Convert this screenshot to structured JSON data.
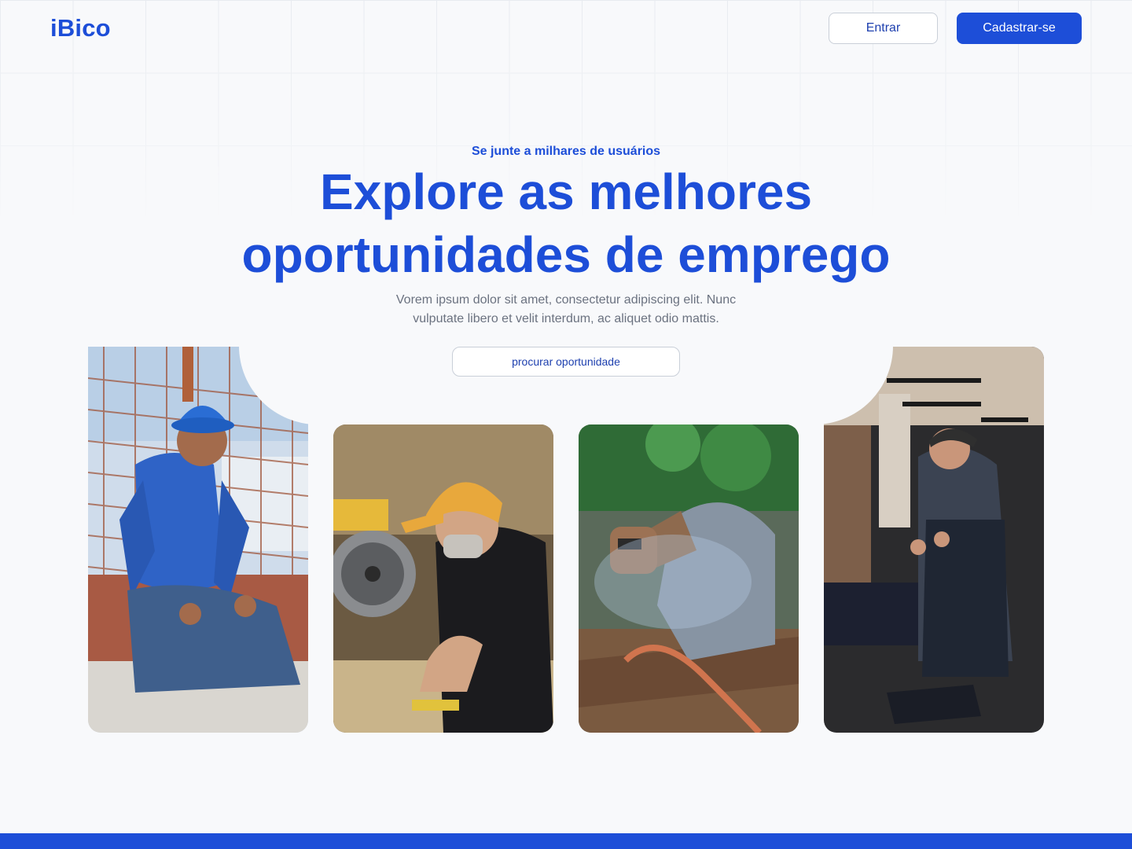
{
  "brand": {
    "name": "iBico"
  },
  "nav": {
    "login_label": "Entrar",
    "signup_label": "Cadastrar-se"
  },
  "hero": {
    "eyebrow": "Se junte a milhares de usuários",
    "headline_line1": "Explore as melhores",
    "headline_line2": "oportunidades de emprego",
    "description_line1": "Vorem ipsum dolor sit amet, consectetur adipiscing elit. Nunc",
    "description_line2": "vulputate libero et velit interdum, ac aliquet odio mattis.",
    "cta_label": "procurar oportunidade"
  },
  "colors": {
    "accent": "#1d4ed8",
    "background": "#f8f9fb",
    "muted_text": "#6b7280"
  },
  "gallery": [
    {
      "subject": "construction-worker-photo"
    },
    {
      "subject": "carpenter-photo"
    },
    {
      "subject": "welder-photo"
    },
    {
      "subject": "blacksmith-photo"
    }
  ]
}
